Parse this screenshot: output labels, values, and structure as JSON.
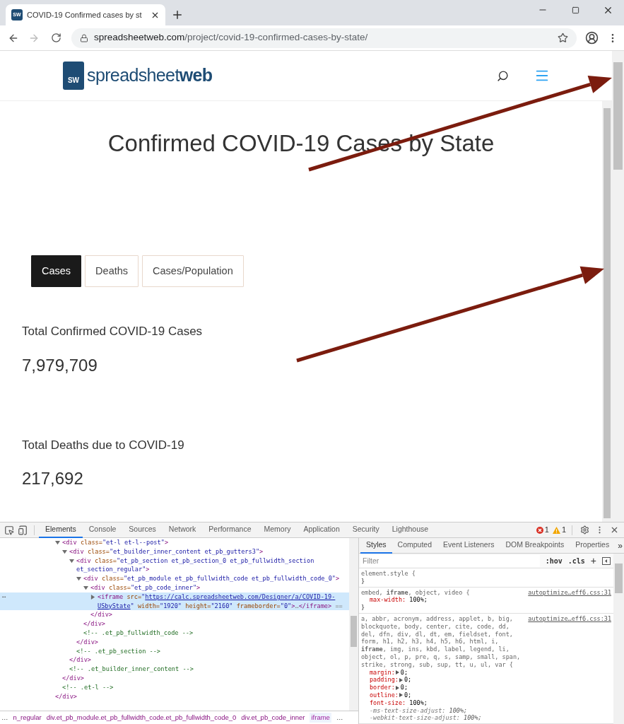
{
  "browser": {
    "tab": {
      "favicon": "SW",
      "title": "COVID-19 Confirmed cases by st"
    },
    "address": {
      "domain": "spreadsheetweb.com",
      "path": "/project/covid-19-confirmed-cases-by-state/"
    }
  },
  "site": {
    "logo": {
      "mark": "SW",
      "light": "spreadsheet",
      "bold": "web"
    }
  },
  "page": {
    "title": "Confirmed COVID-19 Cases by State",
    "tabs": [
      {
        "label": "Cases",
        "selected": true
      },
      {
        "label": "Deaths",
        "selected": false
      },
      {
        "label": "Cases/Population",
        "selected": false
      }
    ],
    "stats": [
      {
        "label": "Total Confirmed COVID-19 Cases",
        "value": "7,979,709"
      },
      {
        "label": "Total Deaths due to COVID-19",
        "value": "217,692"
      }
    ]
  },
  "devtools": {
    "tabs": [
      {
        "label": "Elements",
        "selected": true
      },
      {
        "label": "Console",
        "selected": false
      },
      {
        "label": "Sources",
        "selected": false
      },
      {
        "label": "Network",
        "selected": false
      },
      {
        "label": "Performance",
        "selected": false
      },
      {
        "label": "Memory",
        "selected": false
      },
      {
        "label": "Application",
        "selected": false
      },
      {
        "label": "Security",
        "selected": false
      },
      {
        "label": "Lighthouse",
        "selected": false
      }
    ],
    "errors": "1",
    "warnings": "1",
    "dom_tree": {
      "children": [
        {
          "kind": "element",
          "expanded": true,
          "tokens": [
            {
              "kind": "tag",
              "s": "<div"
            },
            {
              "kind": "attr",
              "s": " class="
            },
            {
              "kind": "value",
              "s": "\"et-l et-l--post\""
            },
            {
              "kind": "tag",
              "s": ">"
            }
          ],
          "children": [
            {
              "kind": "element",
              "expanded": true,
              "tokens": [
                {
                  "kind": "tag",
                  "s": "<div"
                },
                {
                  "kind": "attr",
                  "s": " class="
                },
                {
                  "kind": "value",
                  "s": "\"et_builder_inner_content et_pb_gutters3\""
                },
                {
                  "kind": "tag",
                  "s": ">"
                }
              ],
              "children": [
                {
                  "kind": "element",
                  "expanded": true,
                  "tokens": [
                    {
                      "kind": "tag",
                      "s": "<div"
                    },
                    {
                      "kind": "attr",
                      "s": " class="
                    },
                    {
                      "kind": "value",
                      "s": "\"et_pb_section et_pb_section_0 et_pb_fullwidth_section et_section_regular\""
                    },
                    {
                      "kind": "tag",
                      "s": ">"
                    }
                  ],
                  "children": [
                    {
                      "kind": "element",
                      "expanded": true,
                      "tokens": [
                        {
                          "kind": "tag",
                          "s": "<div"
                        },
                        {
                          "kind": "attr",
                          "s": " class="
                        },
                        {
                          "kind": "value",
                          "s": "\"et_pb_module et_pb_fullwidth_code et_pb_fullwidth_code_0\""
                        },
                        {
                          "kind": "tag",
                          "s": ">"
                        }
                      ],
                      "children": [
                        {
                          "kind": "element",
                          "expanded": true,
                          "tokens": [
                            {
                              "kind": "tag",
                              "s": "<div"
                            },
                            {
                              "kind": "attr",
                              "s": " class="
                            },
                            {
                              "kind": "value",
                              "s": "\"et_pb_code_inner\""
                            },
                            {
                              "kind": "tag",
                              "s": ">"
                            }
                          ],
                          "children": [
                            {
                              "kind": "element",
                              "expanded": false,
                              "selected": true,
                              "gutter": "⋯",
                              "tokens": [
                                {
                                  "kind": "tag",
                                  "s": "<iframe"
                                },
                                {
                                  "kind": "attr",
                                  "s": " src="
                                },
                                {
                                  "kind": "value",
                                  "s": "\""
                                },
                                {
                                  "kind": "link",
                                  "s": "https://calc.spreadsheetweb.com/Designer/a/COVID-19-USbyState"
                                },
                                {
                                  "kind": "value",
                                  "s": "\""
                                },
                                {
                                  "kind": "attr",
                                  "s": " width="
                                },
                                {
                                  "kind": "value",
                                  "s": "\"1920\""
                                },
                                {
                                  "kind": "attr",
                                  "s": " height="
                                },
                                {
                                  "kind": "value",
                                  "s": "\"2160\""
                                },
                                {
                                  "kind": "attr",
                                  "s": " frameborder="
                                },
                                {
                                  "kind": "value",
                                  "s": "\"0\""
                                },
                                {
                                  "kind": "tag",
                                  "s": ">"
                                },
                                {
                                  "kind": "muted",
                                  "s": "…"
                                },
                                {
                                  "kind": "tag",
                                  "s": "</iframe>"
                                },
                                {
                                  "kind": "muted",
                                  "s": " =="
                                }
                              ]
                            }
                          ],
                          "closing": [
                            {
                              "kind": "tag",
                              "s": "</div>"
                            }
                          ]
                        }
                      ],
                      "closing": [
                        {
                          "kind": "tag",
                          "s": "</div>"
                        }
                      ]
                    },
                    {
                      "kind": "comment",
                      "tokens": [
                        {
                          "kind": "comment",
                          "s": "<!-- .et_pb_fullwidth_code -->"
                        }
                      ]
                    }
                  ],
                  "closing": [
                    {
                      "kind": "tag",
                      "s": "</div>"
                    }
                  ]
                },
                {
                  "kind": "comment",
                  "tokens": [
                    {
                      "kind": "comment",
                      "s": "<!-- .et_pb_section -->"
                    }
                  ]
                }
              ],
              "closing": [
                {
                  "kind": "tag",
                  "s": "</div>"
                }
              ]
            },
            {
              "kind": "comment",
              "tokens": [
                {
                  "kind": "comment",
                  "s": "<!-- .et_builder_inner_content -->"
                }
              ]
            }
          ],
          "closing": [
            {
              "kind": "tag",
              "s": "</div>"
            }
          ]
        },
        {
          "kind": "comment",
          "tokens": [
            {
              "kind": "comment",
              "s": "<!-- .et-l -->"
            }
          ]
        }
      ],
      "closing": [
        {
          "kind": "tag",
          "s": "</div>"
        }
      ]
    },
    "breadcrumb": {
      "overflow_left": "…",
      "overflow_right": "…",
      "items": [
        {
          "label": "n_regular",
          "selected": false
        },
        {
          "label": "div.et_pb_module.et_pb_fullwidth_code.et_pb_fullwidth_code_0",
          "selected": false
        },
        {
          "label": "div.et_pb_code_inner",
          "selected": false
        },
        {
          "label": "iframe",
          "selected": true
        }
      ]
    },
    "styles": {
      "tabs": [
        {
          "label": "Styles",
          "selected": true
        },
        {
          "label": "Computed",
          "selected": false
        },
        {
          "label": "Event Listeners",
          "selected": false
        },
        {
          "label": "DOM Breakpoints",
          "selected": false
        },
        {
          "label": "Properties",
          "selected": false
        }
      ],
      "more": "»",
      "filter_placeholder": "Filter",
      "hov": ":hov",
      "cls": ".cls",
      "add": "+",
      "rules": [
        {
          "selector": "element.style {",
          "end": "}"
        },
        {
          "selector": "embed, **iframe**, object, video {",
          "source": "autoptimize…eff6.css:31",
          "end": "}",
          "props": [
            {
              "name": "max-width:",
              "value": "100%;",
              "expandable": false,
              "overridden": false
            }
          ]
        },
        {
          "selector": "a, abbr, acronym, address, applet, b, big, blockquote, body, center, cite, code, dd, del, dfn, div, dl, dt, em, fieldset, font, form, h1, h2, h3, h4, h5, h6, html, i, **iframe**, img, ins, kbd, label, legend, li, object, ol, p, pre, q, s, samp, small, span, strike, strong, sub, sup, tt, u, ul, var {",
          "source": "autoptimize…eff6.css:31",
          "props": [
            {
              "name": "margin:",
              "value": "0;",
              "expandable": true,
              "overridden": false
            },
            {
              "name": "padding:",
              "value": "0;",
              "expandable": true,
              "overridden": false
            },
            {
              "name": "border:",
              "value": "0;",
              "expandable": true,
              "overridden": false
            },
            {
              "name": "outline:",
              "value": "0;",
              "expandable": true,
              "overridden": false
            },
            {
              "name": "font-size:",
              "value": "100%;",
              "expandable": false,
              "overridden": false
            },
            {
              "name": "-ms-text-size-adjust:",
              "value": "100%;",
              "expandable": false,
              "overridden": true
            },
            {
              "name": "-webkit-text-size-adjust:",
              "value": "100%;",
              "expandable": false,
              "overridden": true
            }
          ]
        }
      ]
    }
  }
}
